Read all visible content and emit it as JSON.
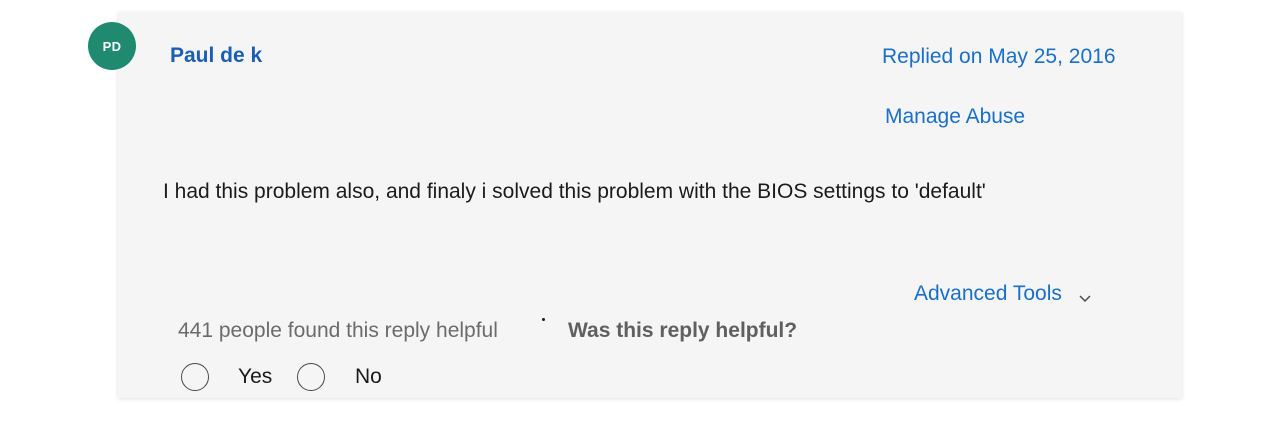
{
  "reply": {
    "avatar_initials": "PD",
    "avatar_color": "#1f8a70",
    "author": "Paul de k",
    "replied_on": "Replied on May 25, 2016",
    "manage_abuse": "Manage Abuse",
    "body": "I had this problem also, and finaly i solved this problem with the BIOS settings to 'default'",
    "advanced_tools": "Advanced Tools",
    "advanced_tools_icon": "chevron-down-icon",
    "helpful_count": "441 people found this reply helpful",
    "helpful_question": "Was this reply helpful?",
    "options": {
      "yes": "Yes",
      "no": "No"
    }
  },
  "colors": {
    "link": "#1a6fc9",
    "card_bg": "#f5f5f5"
  }
}
